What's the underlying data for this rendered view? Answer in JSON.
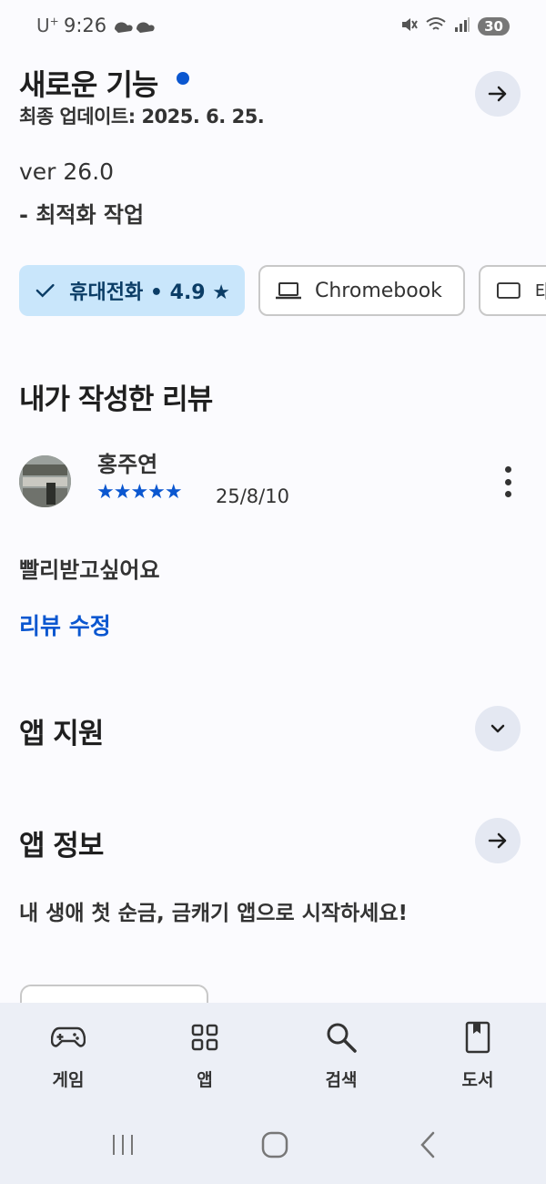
{
  "status_bar": {
    "carrier": "U",
    "carrier_sup": "+",
    "time": "9:26",
    "battery": "30"
  },
  "whats_new": {
    "title": "새로운 기능",
    "updated": "최종 업데이트: 2025. 6. 25.",
    "version": "ver 26.0",
    "notes": "- 최적화 작업"
  },
  "device_chips": [
    {
      "label": "휴대전화 • 4.9 ★",
      "selected": true
    },
    {
      "label": "Chromebook",
      "selected": false
    },
    {
      "label": "태",
      "selected": false
    }
  ],
  "my_review": {
    "title": "내가 작성한 리뷰",
    "reviewer": "홍주연",
    "rating": 5,
    "stars": "★★★★★",
    "date": "25/8/10",
    "text": "빨리받고싶어요",
    "edit_label": "리뷰 수정"
  },
  "app_support": {
    "title": "앱 지원"
  },
  "app_info": {
    "title": "앱 정보",
    "description": "내 생애 첫 순금, 금캐기 앱으로 시작하세요!"
  },
  "bottom_nav": [
    {
      "label": "게임",
      "icon": "gamepad-icon"
    },
    {
      "label": "앱",
      "icon": "apps-grid-icon"
    },
    {
      "label": "검색",
      "icon": "search-icon"
    },
    {
      "label": "도서",
      "icon": "book-icon"
    }
  ],
  "colors": {
    "accent": "#0b57d0",
    "chip_selected": "#c9e6fb",
    "nav_bg": "#eceff6"
  }
}
